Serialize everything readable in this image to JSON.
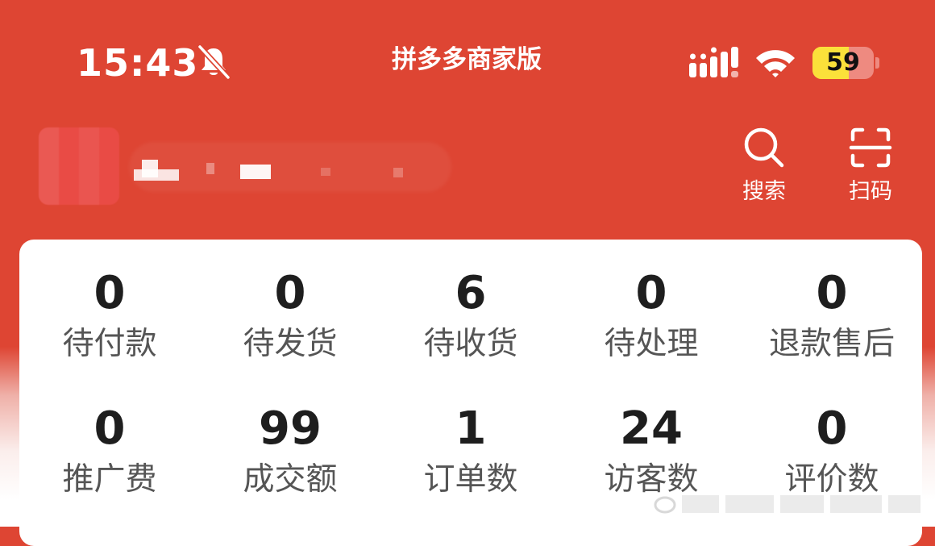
{
  "status_bar": {
    "time": "15:43",
    "app_name": "拼多多商家版",
    "battery": 59
  },
  "header": {
    "store_name": "",
    "actions": [
      {
        "label": "搜索",
        "icon": "search-icon"
      },
      {
        "label": "扫码",
        "icon": "scan-icon"
      }
    ]
  },
  "stats": {
    "row1": [
      {
        "value": "0",
        "label": "待付款"
      },
      {
        "value": "0",
        "label": "待发货"
      },
      {
        "value": "6",
        "label": "待收货"
      },
      {
        "value": "0",
        "label": "待处理"
      },
      {
        "value": "0",
        "label": "退款售后"
      }
    ],
    "row2": [
      {
        "value": "0",
        "label": "推广费"
      },
      {
        "value": "99",
        "label": "成交额"
      },
      {
        "value": "1",
        "label": "订单数"
      },
      {
        "value": "24",
        "label": "访客数"
      },
      {
        "value": "0",
        "label": "评价数"
      }
    ]
  },
  "colors": {
    "brand_red": "#de4533",
    "battery_yellow": "#fbe13a"
  }
}
